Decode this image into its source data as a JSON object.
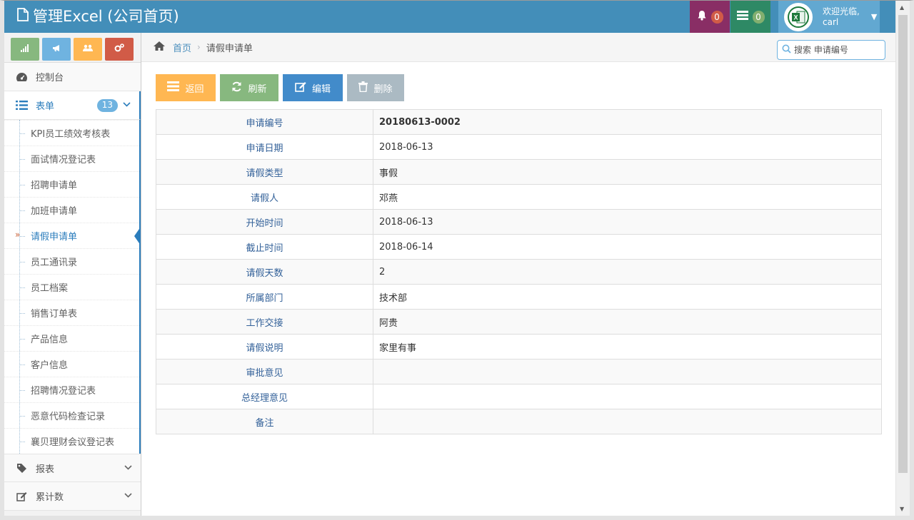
{
  "navbar": {
    "brand": "管理Excel (公司首页)",
    "notifications_count": "0",
    "messages_count": "0",
    "user_greeting": "欢迎光临,",
    "user_name": "carl",
    "brand_color": "#438eb9"
  },
  "sidebar": {
    "shortcuts": [
      {
        "icon": "signal-icon",
        "color": "#87b87f"
      },
      {
        "icon": "bullhorn-icon",
        "color": "#6fb3e0"
      },
      {
        "icon": "users-icon",
        "color": "#ffb752"
      },
      {
        "icon": "cogs-icon",
        "color": "#d15b47"
      }
    ],
    "dashboard_label": "控制台",
    "forms_label": "表单",
    "forms_badge": "13",
    "forms_items": [
      "KPI员工绩效考核表",
      "面试情况登记表",
      "招聘申请单",
      "加班申请单",
      "请假申请单",
      "员工通讯录",
      "员工档案",
      "销售订单表",
      "产品信息",
      "客户信息",
      "招聘情况登记表",
      "恶意代码检查记录",
      "襄贝理财会议登记表"
    ],
    "active_item": "请假申请单",
    "reports_label": "报表",
    "cumulative_label": "累计数"
  },
  "breadcrumbs": {
    "home": "首页",
    "current": "请假申请单"
  },
  "search": {
    "placeholder": "搜索 申请编号"
  },
  "toolbar": {
    "back_label": "返回",
    "refresh_label": "刷新",
    "edit_label": "编辑",
    "delete_label": "删除"
  },
  "detail": {
    "rows": [
      {
        "label": "申请编号",
        "value": "20180613-0002"
      },
      {
        "label": "申请日期",
        "value": "2018-06-13"
      },
      {
        "label": "请假类型",
        "value": "事假"
      },
      {
        "label": "请假人",
        "value": "邓燕"
      },
      {
        "label": "开始时间",
        "value": "2018-06-13"
      },
      {
        "label": "截止时间",
        "value": "2018-06-14"
      },
      {
        "label": "请假天数",
        "value": "2"
      },
      {
        "label": "所属部门",
        "value": "技术部"
      },
      {
        "label": "工作交接",
        "value": "阿贵"
      },
      {
        "label": "请假说明",
        "value": "家里有事"
      },
      {
        "label": "审批意见",
        "value": ""
      },
      {
        "label": "总经理意见",
        "value": ""
      },
      {
        "label": "备注",
        "value": ""
      }
    ]
  }
}
